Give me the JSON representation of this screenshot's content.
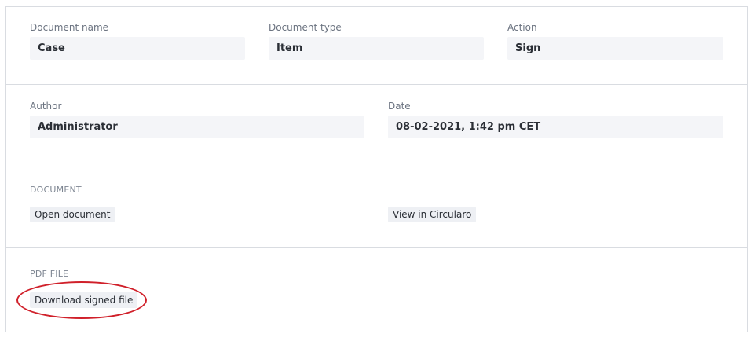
{
  "row1": {
    "document_name": {
      "label": "Document name",
      "value": "Case"
    },
    "document_type": {
      "label": "Document type",
      "value": "Item"
    },
    "action": {
      "label": "Action",
      "value": "Sign"
    }
  },
  "row2": {
    "author": {
      "label": "Author",
      "value": "Administrator"
    },
    "date": {
      "label": "Date",
      "value": "08-02-2021, 1:42 pm CET"
    }
  },
  "document_section": {
    "title": "DOCUMENT",
    "open_document": "Open document",
    "view_in_circularo": "View in Circularo"
  },
  "pdf_section": {
    "title": "PDF FILE",
    "download_signed_file": "Download signed file"
  },
  "annotation": {
    "color": "#d0202a"
  }
}
